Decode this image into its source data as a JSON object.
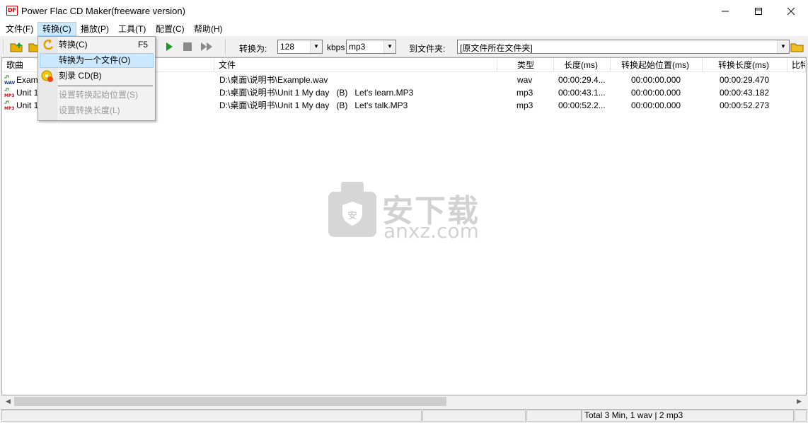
{
  "window": {
    "title": "Power Flac CD Maker(freeware version)",
    "icon_text": "DF"
  },
  "menu": [
    "文件(F)",
    "转换(C)",
    "播放(P)",
    "工具(T)",
    "配置(C)",
    "帮助(H)"
  ],
  "convert_menu": {
    "items": [
      {
        "label": "转换(C)",
        "shortcut": "F5"
      },
      {
        "label": "转换为一个文件(O)"
      },
      {
        "label": "刻录 CD(B)"
      },
      {
        "label": "设置转换起始位置(S)"
      },
      {
        "label": "设置转换长度(L)"
      }
    ]
  },
  "toolbar": {
    "convert_to_label": "转换为:",
    "bitrate": "128",
    "kbps_label": "kbps",
    "format": "mp3",
    "folder_label": "到文件夹:",
    "folder": "[原文件所在文件夹]"
  },
  "table": {
    "columns": [
      "歌曲",
      "文件",
      "类型",
      "长度(ms)",
      "转换起始位置(ms)",
      "转换长度(ms)",
      "比特"
    ],
    "rows": [
      {
        "icon": "WAV",
        "song": "Exam",
        "file": "D:\\桌面\\说明书\\Example.wav",
        "type": "wav",
        "length": "00:00:29.4...",
        "start": "00:00:00.000",
        "conv_length": "00:00:29.470"
      },
      {
        "icon": "MP3",
        "song": "Unit 1",
        "file": "D:\\桌面\\说明书\\Unit 1 My day   (B)   Let's learn.MP3",
        "type": "mp3",
        "length": "00:00:43.1...",
        "start": "00:00:00.000",
        "conv_length": "00:00:43.182"
      },
      {
        "icon": "MP3",
        "song": "Unit 1",
        "file": "D:\\桌面\\说明书\\Unit 1 My day   (B)   Let's talk.MP3",
        "type": "mp3",
        "length": "00:00:52.2...",
        "start": "00:00:00.000",
        "conv_length": "00:00:52.273"
      }
    ]
  },
  "watermark": {
    "text": "安下载",
    "sub": "anxz.com"
  },
  "status": {
    "summary": "Total 3 Min, 1 wav | 2 mp3"
  }
}
